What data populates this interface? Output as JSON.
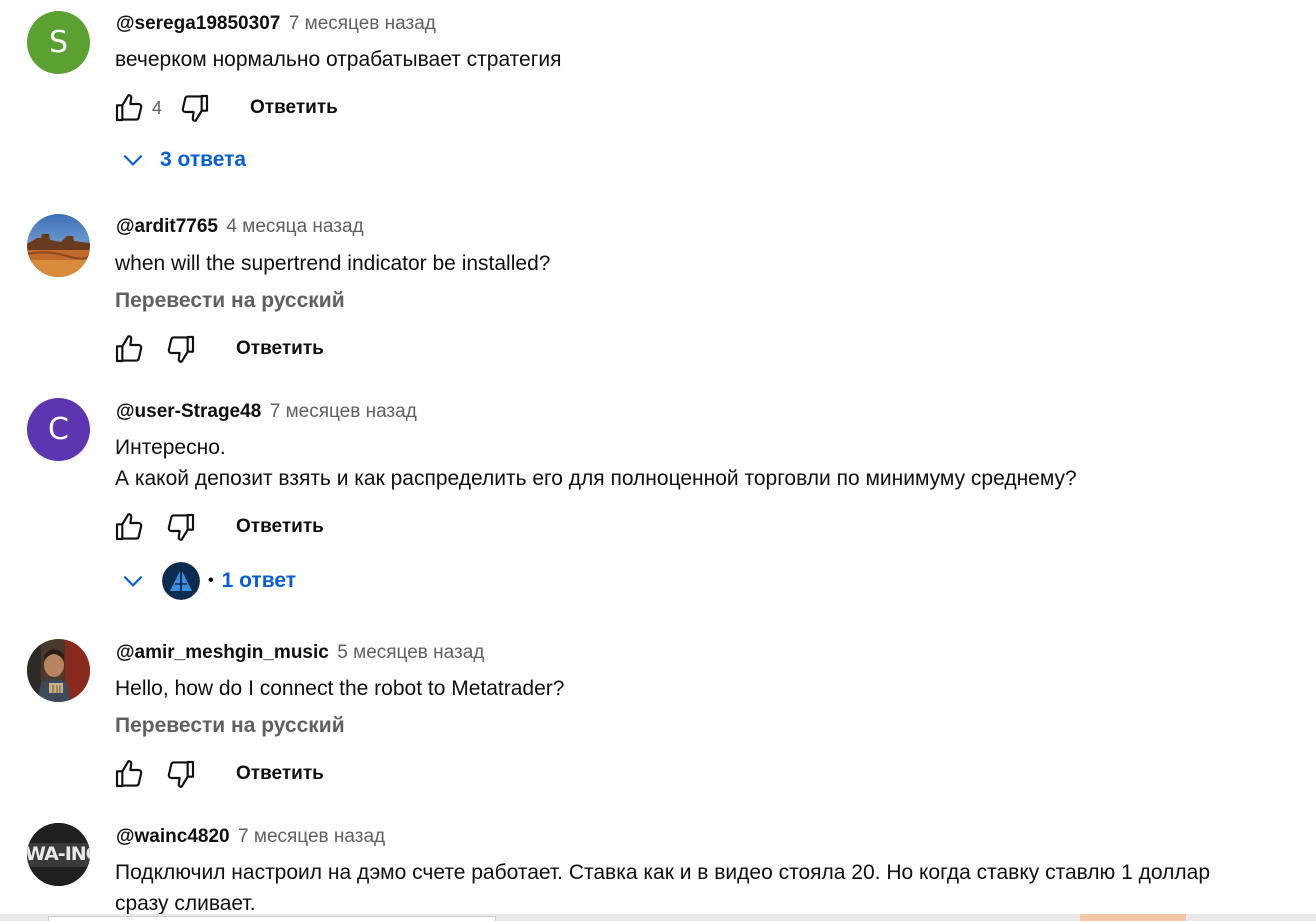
{
  "colors": {
    "author_text": "#0f0f0f",
    "meta_text": "#606060",
    "link_blue": "#065fd4",
    "avatar_green": "#5aa132",
    "avatar_purple": "#5e35b1"
  },
  "actions": {
    "reply_label": "Ответить",
    "translate_label": "Перевести на русский"
  },
  "comments": [
    {
      "author": "@serega19850307",
      "time": "7 месяцев назад",
      "avatar_letter": "S",
      "text": [
        "вечерком нормально отрабатывает стратегия"
      ],
      "likes": "4",
      "replies_label": "3 ответа"
    },
    {
      "author": "@ardit7765",
      "time": "4 месяца назад",
      "avatar_icon": "desert-landscape-avatar",
      "text": [
        "when will the supertrend indicator be installed?"
      ]
    },
    {
      "author": "@user-Strage48",
      "time": "7 месяцев назад",
      "avatar_letter": "С",
      "text": [
        "Интересно.",
        "А какой депозит взять и как распределить его для полноценной торговли по минимуму среднему?"
      ],
      "replies_label": "1 ответ"
    },
    {
      "author": "@amir_meshgin_music",
      "time": "5 месяцев назад",
      "avatar_icon": "person-photo-avatar",
      "text": [
        "Hello, how do I connect the robot to Metatrader?"
      ]
    },
    {
      "author": "@wainc4820",
      "time": "7 месяцев назад",
      "avatar_text": "WA-INC",
      "text": [
        "Подключил настроил на дэмо счете работает. Ставка как и в видео стояла 20. Но когда ставку ставлю 1 доллар",
        "сразу сливает."
      ]
    }
  ]
}
